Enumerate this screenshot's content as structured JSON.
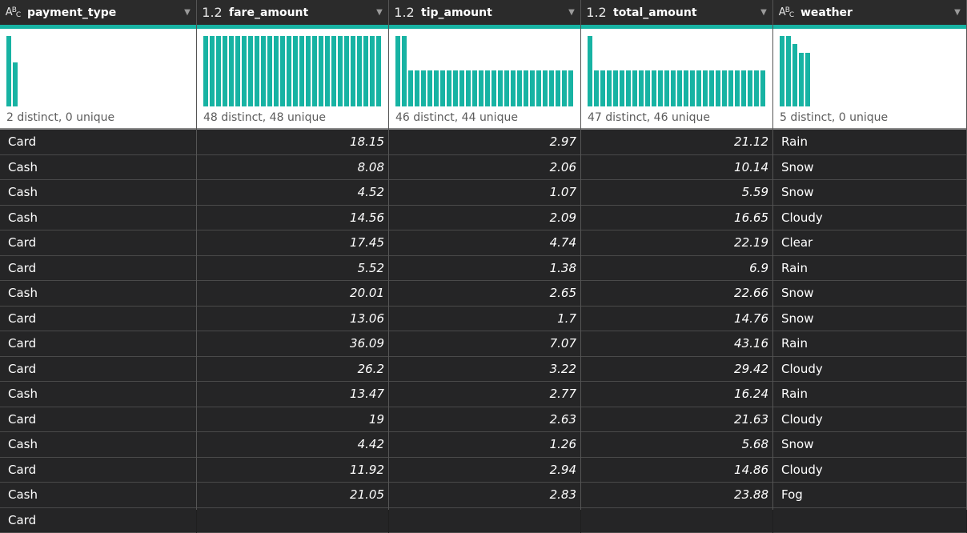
{
  "columns": [
    {
      "name": "payment_type",
      "type_label": "text",
      "stats": "2 distinct, 0 unique",
      "hist": [
        1.0,
        0.62
      ]
    },
    {
      "name": "fare_amount",
      "type_label": "1.2",
      "stats": "48 distinct, 48 unique",
      "hist": [
        1,
        1,
        1,
        1,
        1,
        1,
        1,
        1,
        1,
        1,
        1,
        1,
        1,
        1,
        1,
        1,
        1,
        1,
        1,
        1,
        1,
        1,
        1,
        1,
        1,
        1,
        1,
        1
      ]
    },
    {
      "name": "tip_amount",
      "type_label": "1.2",
      "stats": "46 distinct, 44 unique",
      "hist": [
        1,
        1,
        0.51,
        0.51,
        0.51,
        0.51,
        0.51,
        0.51,
        0.51,
        0.51,
        0.51,
        0.51,
        0.51,
        0.51,
        0.51,
        0.51,
        0.51,
        0.51,
        0.51,
        0.51,
        0.51,
        0.51,
        0.51,
        0.51,
        0.51,
        0.51,
        0.51,
        0.51
      ]
    },
    {
      "name": "total_amount",
      "type_label": "1.2",
      "stats": "47 distinct, 46 unique",
      "hist": [
        1,
        0.51,
        0.51,
        0.51,
        0.51,
        0.51,
        0.51,
        0.51,
        0.51,
        0.51,
        0.51,
        0.51,
        0.51,
        0.51,
        0.51,
        0.51,
        0.51,
        0.51,
        0.51,
        0.51,
        0.51,
        0.51,
        0.51,
        0.51,
        0.51,
        0.51,
        0.51,
        0.51
      ]
    },
    {
      "name": "weather",
      "type_label": "text",
      "stats": "5 distinct, 0 unique",
      "hist": [
        1,
        1,
        0.89,
        0.76,
        0.76
      ]
    }
  ],
  "rows": [
    [
      "Card",
      "18.15",
      "2.97",
      "21.12",
      "Rain"
    ],
    [
      "Cash",
      "8.08",
      "2.06",
      "10.14",
      "Snow"
    ],
    [
      "Cash",
      "4.52",
      "1.07",
      "5.59",
      "Snow"
    ],
    [
      "Cash",
      "14.56",
      "2.09",
      "16.65",
      "Cloudy"
    ],
    [
      "Card",
      "17.45",
      "4.74",
      "22.19",
      "Clear"
    ],
    [
      "Card",
      "5.52",
      "1.38",
      "6.9",
      "Rain"
    ],
    [
      "Cash",
      "20.01",
      "2.65",
      "22.66",
      "Snow"
    ],
    [
      "Card",
      "13.06",
      "1.7",
      "14.76",
      "Snow"
    ],
    [
      "Card",
      "36.09",
      "7.07",
      "43.16",
      "Rain"
    ],
    [
      "Card",
      "26.2",
      "3.22",
      "29.42",
      "Cloudy"
    ],
    [
      "Cash",
      "13.47",
      "2.77",
      "16.24",
      "Rain"
    ],
    [
      "Card",
      "19",
      "2.63",
      "21.63",
      "Cloudy"
    ],
    [
      "Cash",
      "4.42",
      "1.26",
      "5.68",
      "Snow"
    ],
    [
      "Card",
      "11.92",
      "2.94",
      "14.86",
      "Cloudy"
    ],
    [
      "Cash",
      "21.05",
      "2.83",
      "23.88",
      "Fog"
    ],
    [
      "Card",
      "",
      "",
      "",
      ""
    ]
  ],
  "colors": {
    "accent": "#17b3a3",
    "background": "#252526",
    "header": "#2b2b2b"
  }
}
